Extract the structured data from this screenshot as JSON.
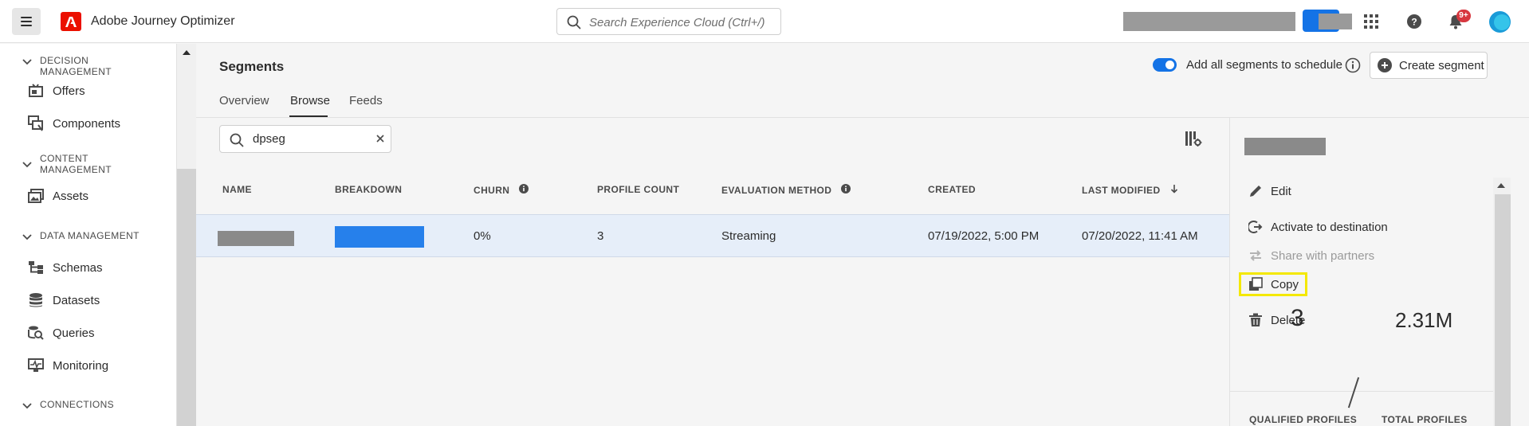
{
  "app": {
    "name": "Adobe Journey Optimizer"
  },
  "search": {
    "placeholder": "Search Experience Cloud (Ctrl+/)"
  },
  "topbar": {
    "notifications_badge": "9+"
  },
  "sidebar": {
    "sections": [
      {
        "title": "DECISION MANAGEMENT",
        "items": [
          "Offers",
          "Components"
        ]
      },
      {
        "title": "CONTENT MANAGEMENT",
        "items": [
          "Assets"
        ]
      },
      {
        "title": "DATA MANAGEMENT",
        "items": [
          "Schemas",
          "Datasets",
          "Queries",
          "Monitoring"
        ]
      },
      {
        "title": "CONNECTIONS",
        "items": []
      }
    ]
  },
  "page": {
    "title": "Segments",
    "toggle_label": "Add all segments to schedule",
    "create_button": "Create segment",
    "tabs": [
      "Overview",
      "Browse",
      "Feeds"
    ],
    "active_tab": "Browse"
  },
  "filter": {
    "value": "dpseg"
  },
  "table": {
    "headers": [
      "NAME",
      "BREAKDOWN",
      "CHURN",
      "PROFILE COUNT",
      "EVALUATION METHOD",
      "CREATED",
      "LAST MODIFIED"
    ],
    "rows": [
      {
        "churn": "0%",
        "profile_count": "3",
        "evaluation_method": "Streaming",
        "created": "07/19/2022, 5:00 PM",
        "last_modified": "07/20/2022, 11:41 AM"
      }
    ]
  },
  "panel": {
    "actions": [
      "Edit",
      "Activate to destination",
      "Share with partners",
      "Copy",
      "Delete"
    ],
    "qualified_profiles": "3",
    "qualified_label": "QUALIFIED PROFILES",
    "total_profiles": "2.31M",
    "total_label": "TOTAL PROFILES"
  },
  "colors": {
    "accent": "#1473e6",
    "adobe_red": "#eb1000",
    "highlight": "#f4e800",
    "row_selected": "#e6eef9"
  }
}
